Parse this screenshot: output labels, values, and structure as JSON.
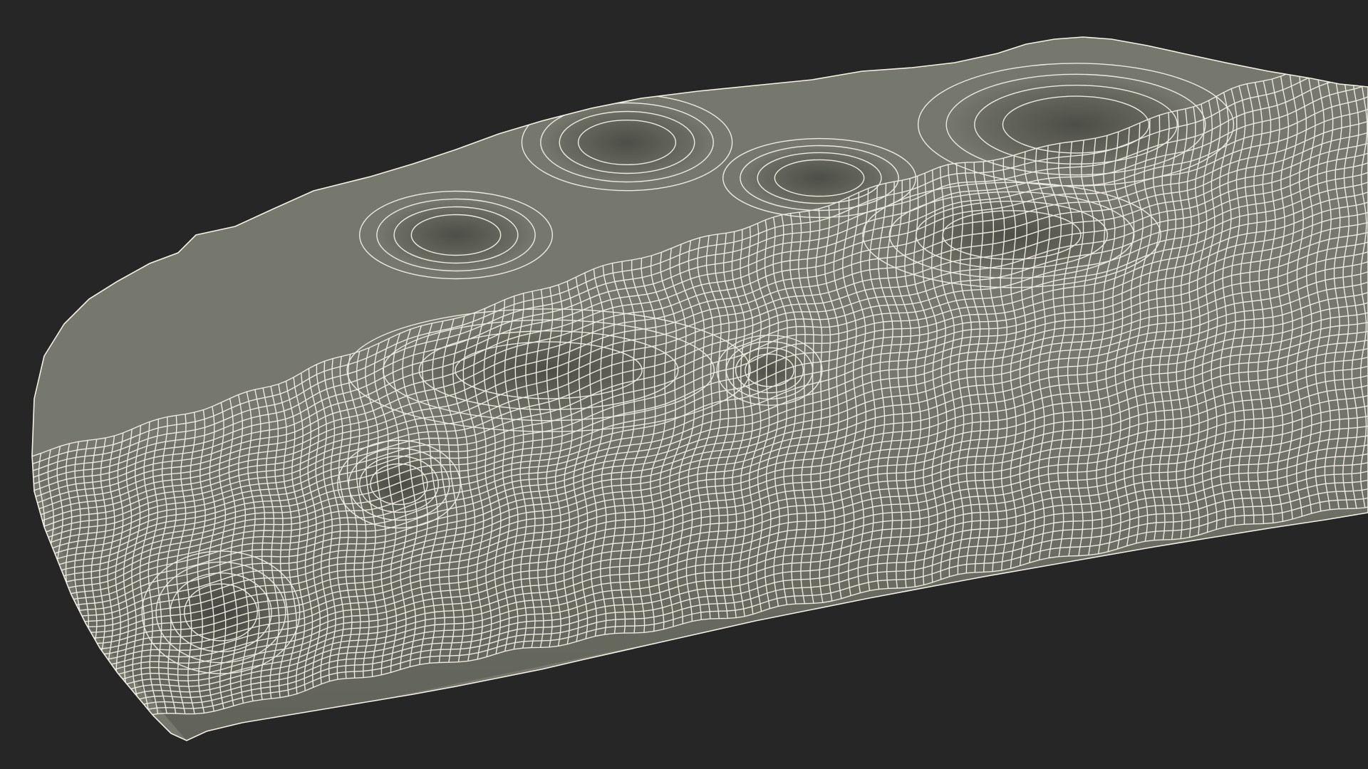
{
  "scene": {
    "background_color": "#262626",
    "surface_color": "#76786d",
    "surface_highlight_color": "#8a8c80",
    "surface_shadow_color": "#4f5148",
    "wire_color": "#f4f1e6",
    "subject": "wireframe-terrain-mesh"
  }
}
